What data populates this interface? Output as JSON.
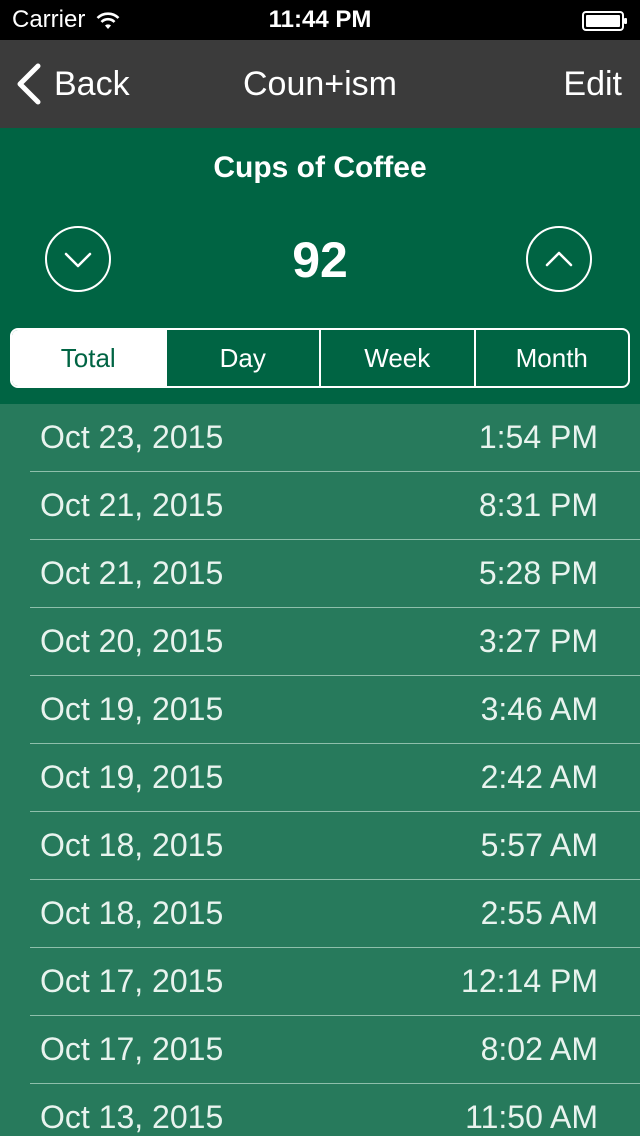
{
  "status_bar": {
    "carrier": "Carrier",
    "time": "11:44 PM"
  },
  "nav": {
    "back_label": "Back",
    "title": "Coun+ism",
    "edit_label": "Edit"
  },
  "counter": {
    "title": "Cups of Coffee",
    "value": "92"
  },
  "segments": [
    "Total",
    "Day",
    "Week",
    "Month"
  ],
  "selected_segment": "Total",
  "entries": [
    {
      "date": "Oct 23, 2015",
      "time": "1:54 PM"
    },
    {
      "date": "Oct 21, 2015",
      "time": "8:31 PM"
    },
    {
      "date": "Oct 21, 2015",
      "time": "5:28 PM"
    },
    {
      "date": "Oct 20, 2015",
      "time": "3:27 PM"
    },
    {
      "date": "Oct 19, 2015",
      "time": "3:46 AM"
    },
    {
      "date": "Oct 19, 2015",
      "time": "2:42 AM"
    },
    {
      "date": "Oct 18, 2015",
      "time": "5:57 AM"
    },
    {
      "date": "Oct 18, 2015",
      "time": "2:55 AM"
    },
    {
      "date": "Oct 17, 2015",
      "time": "12:14 PM"
    },
    {
      "date": "Oct 17, 2015",
      "time": "8:02 AM"
    },
    {
      "date": "Oct 13, 2015",
      "time": "11:50 AM"
    }
  ],
  "colors": {
    "header_green": "#006443",
    "list_green": "#277a5c",
    "nav_gray": "#3b3b3b"
  },
  "icons": {
    "wifi": "wifi-icon",
    "battery": "battery-icon",
    "back": "chevron-left-icon",
    "decrement": "chevron-down-icon",
    "increment": "chevron-up-icon"
  }
}
